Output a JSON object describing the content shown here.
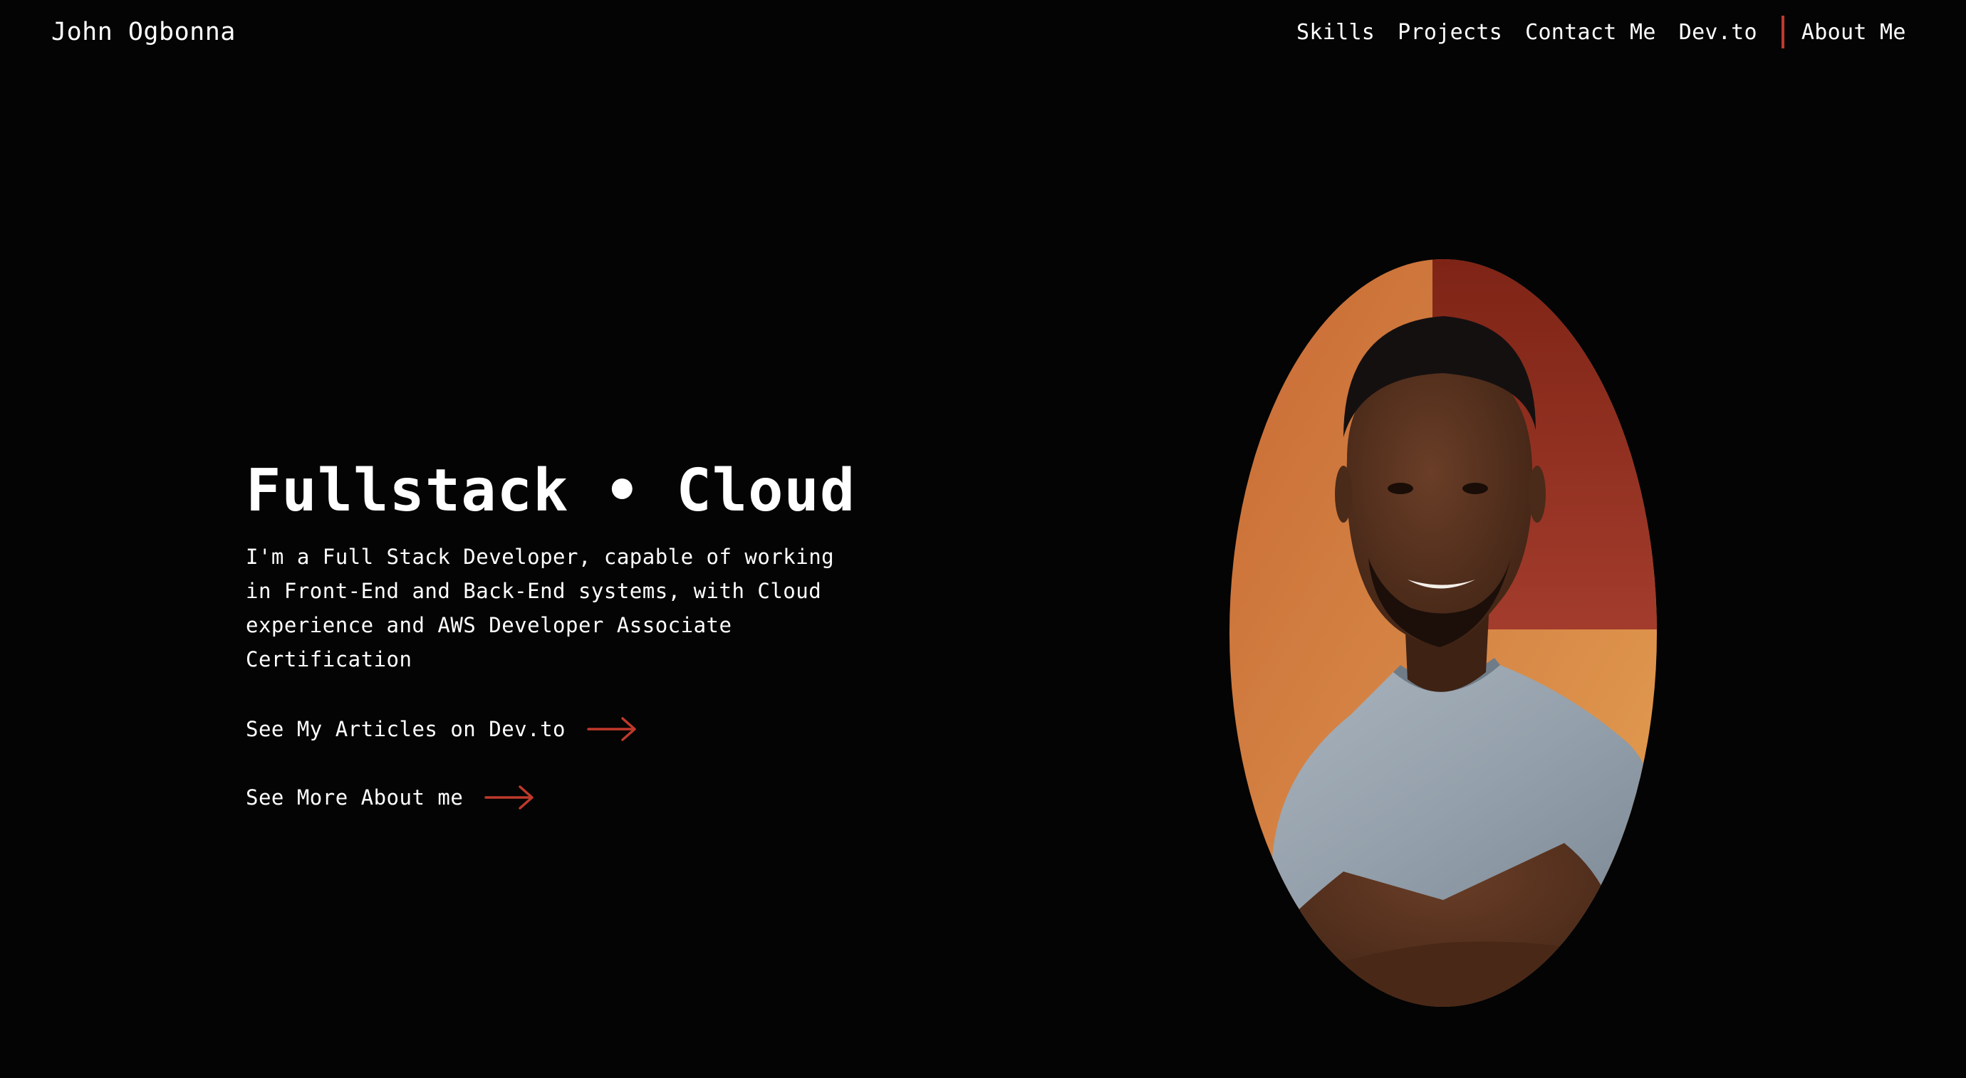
{
  "brand": {
    "name": "John Ogbonna"
  },
  "nav": {
    "items": [
      {
        "label": "Skills"
      },
      {
        "label": "Projects"
      },
      {
        "label": "Contact Me"
      },
      {
        "label": "Dev.to"
      }
    ],
    "about_label": "About Me"
  },
  "hero": {
    "title": "Fullstack • Cloud",
    "description": "I'm a Full Stack Developer, capable of working in Front-End and Back-End systems, with Cloud experience and AWS Developer Associate Certification",
    "cta_articles": "See My Articles on Dev.to",
    "cta_about": "See More About me"
  },
  "icons": {
    "cta_arrow": "arrow-right-icon"
  },
  "colors": {
    "background": "#040404",
    "text": "#ffffff",
    "accent": "#c0392b"
  }
}
